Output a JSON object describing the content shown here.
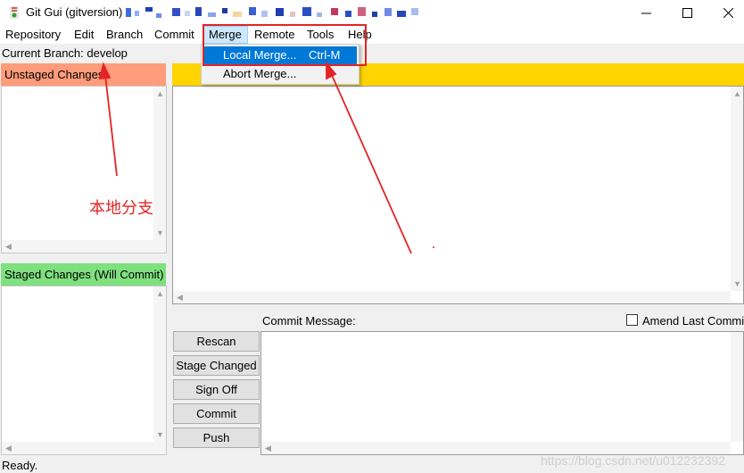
{
  "window": {
    "title": "Git Gui (gitversion)",
    "min_icon": "minimize-icon",
    "max_icon": "maximize-icon",
    "close_icon": "close-icon"
  },
  "menubar": {
    "items": [
      "Repository",
      "Edit",
      "Branch",
      "Commit",
      "Merge",
      "Remote",
      "Tools",
      "Help"
    ]
  },
  "merge_menu": {
    "items": [
      {
        "label": "Local Merge...",
        "shortcut": "Ctrl-M"
      },
      {
        "label": "Abort Merge...",
        "shortcut": ""
      }
    ]
  },
  "branch": {
    "text": "Current Branch: develop"
  },
  "panes": {
    "unstaged_title": "Unstaged Changes",
    "staged_title": "Staged Changes (Will Commit)"
  },
  "commit": {
    "message_label": "Commit Message:",
    "amend_label": "Amend Last Commit",
    "amend_checked": false
  },
  "buttons": {
    "rescan": "Rescan",
    "stage_changed": "Stage Changed",
    "sign_off": "Sign Off",
    "commit": "Commit",
    "push": "Push"
  },
  "status": {
    "text": "Ready."
  },
  "annotation": {
    "text": "本地分支"
  },
  "watermark": {
    "text": "https://blog.csdn.net/u012232392"
  },
  "colors": {
    "unstaged_header": "#ff9c7b",
    "staged_header": "#7fe07f",
    "diff_header": "#ffd400",
    "menu_highlight": "#0078d7",
    "annotation_red": "#e32424"
  }
}
